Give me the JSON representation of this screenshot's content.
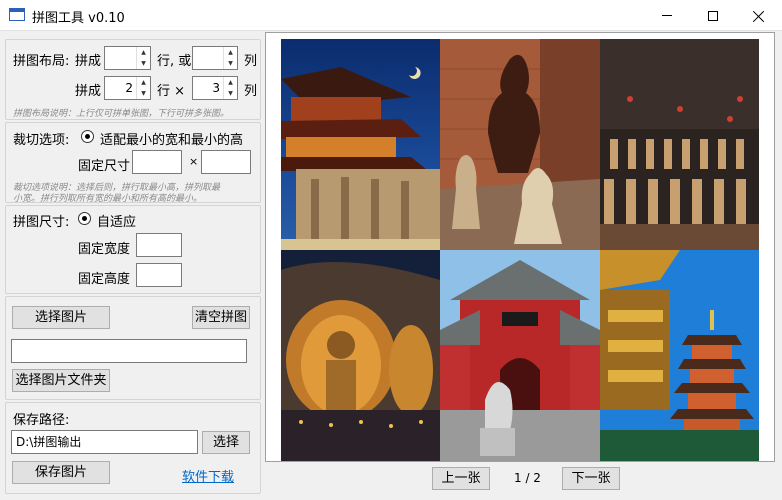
{
  "window": {
    "title": "拼图工具 v0.10"
  },
  "layout": {
    "title": "拼图布局:",
    "row1": {
      "prefix": "拼成",
      "rows_value": "",
      "mid": "行, 或",
      "cols_value": "",
      "suffix": "列"
    },
    "row2": {
      "prefix": "拼成",
      "rows_value": "2",
      "mid": "行 ×",
      "cols_value": "3",
      "suffix": "列"
    },
    "hint": "拼图布局说明：上行仅可拼单张图，下行可拼多张图。"
  },
  "crop": {
    "title": "裁切选项:",
    "radio_label": "适配最小的宽和最小的高",
    "fixed_label": "固定尺寸",
    "times": "×",
    "width_value": "",
    "height_value": "",
    "hint_line1": "裁切选项说明：选择后则，拼行取最小高，拼列取最",
    "hint_line2": "小宽。拼行列取所有宽的最小和所有高的最小。"
  },
  "size": {
    "title": "拼图尺寸:",
    "radio_label": "自适应",
    "width_label": "固定宽度",
    "height_label": "固定高度",
    "width_value": "",
    "height_value": ""
  },
  "images": {
    "select_button": "选择图片",
    "clear_button": "清空拼图",
    "path_value": "",
    "select_folder_button": "选择图片文件夹"
  },
  "save": {
    "title": "保存路径:",
    "path_value": "D:\\拼图输出",
    "choose_button": "选择",
    "save_button": "保存图片",
    "download_link": "软件下载"
  },
  "pager": {
    "prev": "上一张",
    "indicator": "1 / 2",
    "next": "下一张"
  },
  "colors": {
    "accent_link": "#0066cc",
    "window_bg": "#f0f0f0"
  }
}
